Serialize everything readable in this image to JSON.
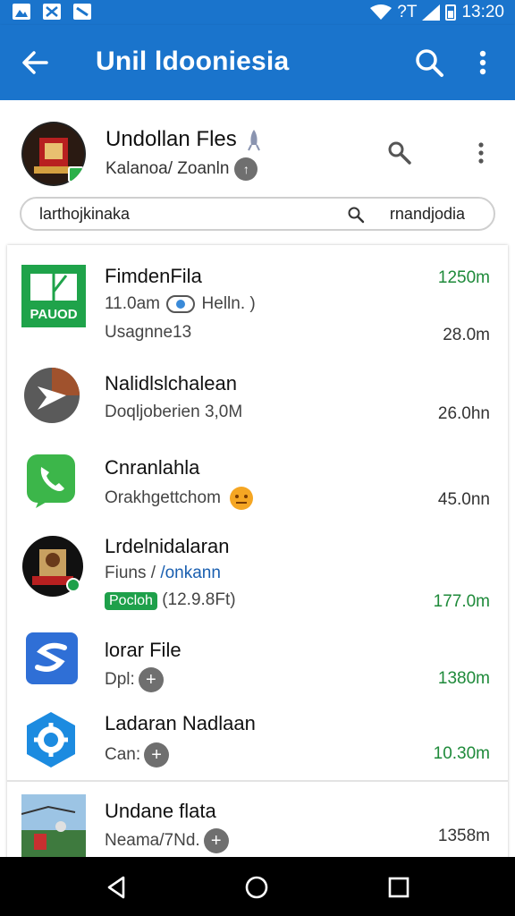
{
  "status_bar": {
    "time": "13:20",
    "network": "?T",
    "left_icons": [
      "image-notification-icon",
      "x-notification-icon",
      "message-notification-icon"
    ]
  },
  "app_bar": {
    "title": "Unil ldooniesia"
  },
  "profile": {
    "title": "Undollan Fles",
    "subtitle": "Kalanoa/ Zoanln"
  },
  "search": {
    "left_label": "larthojkinaka",
    "right_label": "rnandjodia"
  },
  "files": [
    {
      "title": "FimdenFila",
      "sub1": "11.0am",
      "sub1b": "Helln.   )",
      "sub2": "Usagnne13",
      "size_top": "1250m",
      "size_bottom": "28.0m"
    },
    {
      "title": "Nalidlslchalean",
      "sub": "Doqljoberien 3,0M",
      "size": "26.0hn"
    },
    {
      "title": "Cnranlahla",
      "sub": "Orakhgettchom",
      "size": "45.0nn"
    },
    {
      "title": "Lrdelnidalaran",
      "sub1a": "Fiuns /",
      "sub1b": "/onkann",
      "tag": "Pocloh",
      "sub2": "(12.9.8Ft)",
      "size": "177.0m"
    },
    {
      "title": "lorar File",
      "sub": "Dpl:",
      "size": "1380m"
    },
    {
      "title": "Ladaran Nadlaan",
      "sub": "Can:",
      "size": "10.30m"
    },
    {
      "title": "Undane flata",
      "sub": "Neama/7Nd.",
      "size": "1358m"
    }
  ],
  "icons": {
    "row1_thumb_text": "PAUOD"
  },
  "colors": {
    "primary": "#1a74cc",
    "green_size": "#1e8a3a",
    "tag_green": "#1ea04a"
  }
}
